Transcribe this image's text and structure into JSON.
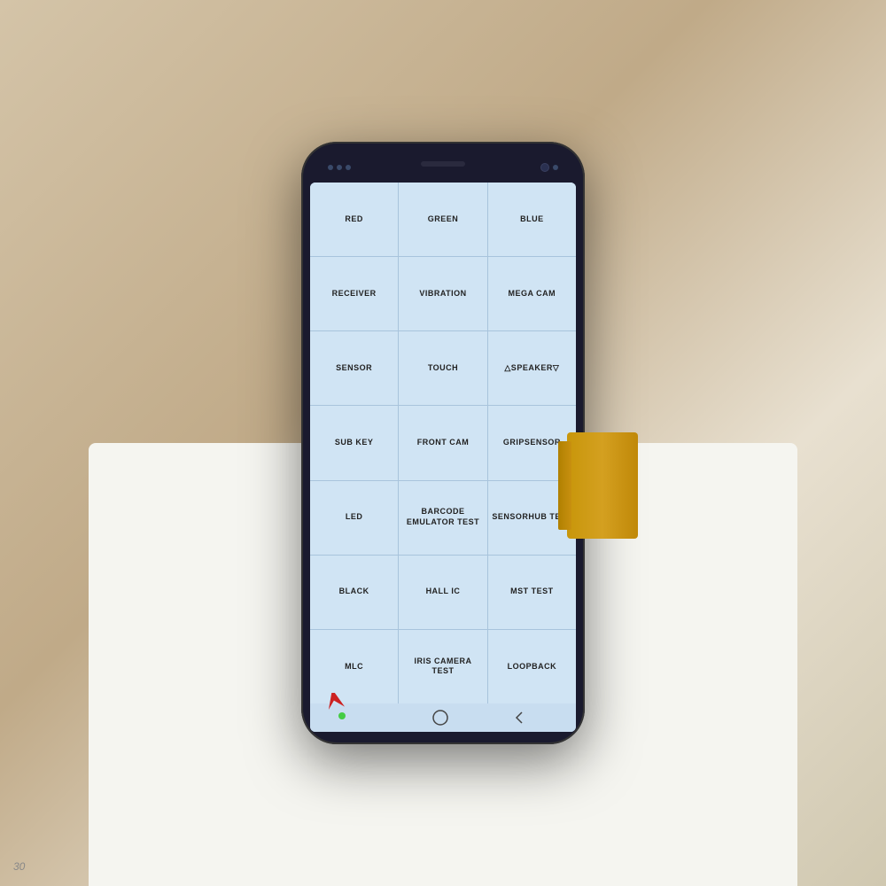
{
  "phone": {
    "screen_bg": "#c8ddf0",
    "grid_bg": "#d0e4f4",
    "grid_border": "#a8c4dc"
  },
  "grid": {
    "cells": [
      {
        "id": "red",
        "label": "RED"
      },
      {
        "id": "green",
        "label": "GREEN"
      },
      {
        "id": "blue",
        "label": "BLUE"
      },
      {
        "id": "receiver",
        "label": "RECEIVER"
      },
      {
        "id": "vibration",
        "label": "VIBRATION"
      },
      {
        "id": "mega-cam",
        "label": "MEGA CAM"
      },
      {
        "id": "sensor",
        "label": "SENSOR"
      },
      {
        "id": "touch",
        "label": "TOUCH"
      },
      {
        "id": "speaker",
        "label": "△SPEAKER▽"
      },
      {
        "id": "sub-key",
        "label": "SUB KEY"
      },
      {
        "id": "front-cam",
        "label": "FRONT CAM"
      },
      {
        "id": "gripsensor",
        "label": "GRIPSENSOR"
      },
      {
        "id": "led",
        "label": "LED"
      },
      {
        "id": "barcode-emulator-test",
        "label": "BARCODE EMULATOR TEST"
      },
      {
        "id": "sensorhub-test",
        "label": "SENSORHUB TEST"
      },
      {
        "id": "black",
        "label": "BLACK"
      },
      {
        "id": "hall-ic",
        "label": "HALL IC"
      },
      {
        "id": "mst-test",
        "label": "MST TEST"
      },
      {
        "id": "mlc",
        "label": "MLC"
      },
      {
        "id": "iris-camera-test",
        "label": "IRIS CAMERA TEST"
      },
      {
        "id": "loopback",
        "label": "LOOPBACK"
      }
    ]
  },
  "nav": {
    "recent_icon": "|||",
    "home_icon": "○",
    "back_icon": "‹"
  },
  "watermark": "30"
}
